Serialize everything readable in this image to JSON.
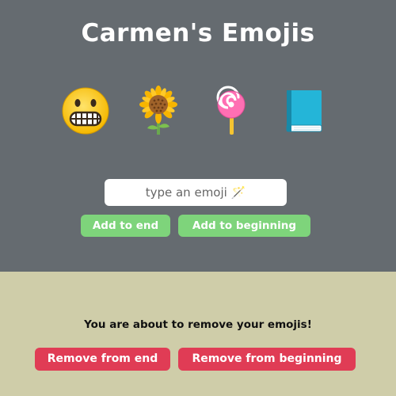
{
  "header": {
    "title": "Carmen's Emojis"
  },
  "emojis": {
    "items": [
      {
        "name": "grimacing-face-icon"
      },
      {
        "name": "sunflower-icon"
      },
      {
        "name": "lollipop-icon"
      },
      {
        "name": "blue-book-icon"
      }
    ]
  },
  "add_section": {
    "input_placeholder": "type an emoji 🪄",
    "input_value": "",
    "add_to_end_label": "Add to end",
    "add_to_beginning_label": "Add to beginning"
  },
  "remove_section": {
    "warning_text": "You are about to remove your emojis!",
    "remove_from_end_label": "Remove from end",
    "remove_from_beginning_label": "Remove from beginning"
  },
  "colors": {
    "top_background": "#656b70",
    "bottom_background": "#cfcda9",
    "add_button": "#7ed47b",
    "remove_button": "#e03c55"
  }
}
